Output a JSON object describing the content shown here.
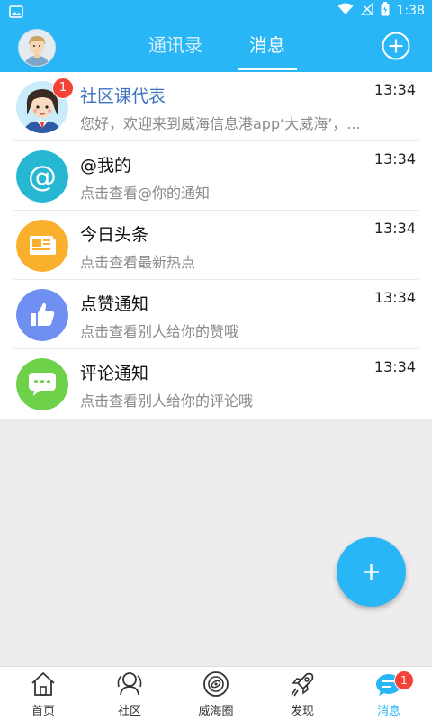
{
  "status_bar": {
    "time": "1:38"
  },
  "header": {
    "tabs": [
      {
        "label": "通讯录"
      },
      {
        "label": "消息"
      }
    ],
    "active_tab": "消息"
  },
  "messages": [
    {
      "title": "社区课代表",
      "preview": "您好，欢迎来到威海信息港app‘大威海’，...",
      "time": "13:34",
      "badge": "1",
      "icon": "girl-avatar-icon"
    },
    {
      "title": "@我的",
      "preview": "点击查看@你的通知",
      "time": "13:34",
      "icon": "at-icon"
    },
    {
      "title": "今日头条",
      "preview": "点击查看最新热点",
      "time": "13:34",
      "icon": "newspaper-icon"
    },
    {
      "title": "点赞通知",
      "preview": "点击查看别人给你的赞哦",
      "time": "13:34",
      "icon": "thumbs-up-icon"
    },
    {
      "title": "评论通知",
      "preview": "点击查看别人给你的评论哦",
      "time": "13:34",
      "icon": "chat-bubble-icon"
    }
  ],
  "bottom_nav": [
    {
      "label": "首页",
      "icon": "home-icon"
    },
    {
      "label": "社区",
      "icon": "community-icon"
    },
    {
      "label": "威海圈",
      "icon": "circle-icon"
    },
    {
      "label": "发现",
      "icon": "rocket-icon"
    },
    {
      "label": "消息",
      "icon": "message-icon",
      "badge": "1"
    }
  ],
  "colors": {
    "accent": "#29b6f6",
    "badge": "#f44336",
    "at": "#26b7d3",
    "news": "#fbb02d",
    "like": "#6f8ff3",
    "comment": "#6dd14a"
  }
}
